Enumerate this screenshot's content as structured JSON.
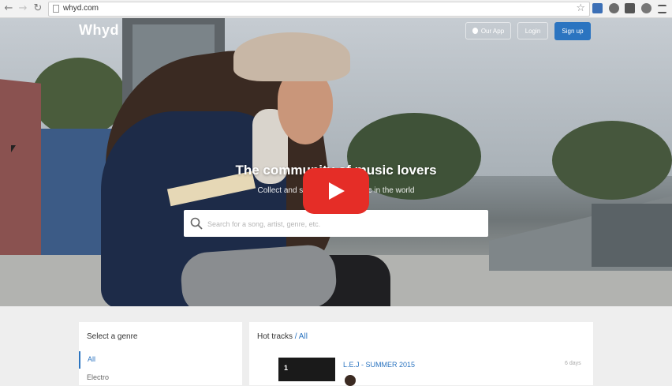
{
  "browser": {
    "url": "whyd.com",
    "back_icon": "back-arrow-icon",
    "forward_icon": "forward-arrow-icon",
    "reload_icon": "reload-icon",
    "extensions": [
      {
        "name": "extension-blue",
        "color": "#3b6fb6"
      },
      {
        "name": "extension-gray",
        "color": "#6c6c6c"
      },
      {
        "name": "pocket-icon",
        "color": "#555555"
      },
      {
        "name": "extension-shield",
        "color": "#777777"
      },
      {
        "name": "menu-icon",
        "color": "#555555"
      }
    ]
  },
  "header": {
    "logo": "Whyd",
    "app_button": "Our App",
    "login_button": "Login",
    "signup_button": "Sign up"
  },
  "hero": {
    "tagline": "The community of music lovers",
    "subline": "Collect and share the best music in the world",
    "search_placeholder": "Search for a song, artist, genre, etc."
  },
  "genres": {
    "title": "Select a genre",
    "items": [
      "All",
      "Electro"
    ]
  },
  "hot_tracks": {
    "title": "Hot tracks",
    "filter": "/ All",
    "tracks": [
      {
        "rank": "1",
        "title": "L.E.J - SUMMER 2015",
        "ago": "6 days"
      }
    ]
  },
  "colors": {
    "accent": "#2b74c0",
    "play_button": "#e52d27"
  }
}
